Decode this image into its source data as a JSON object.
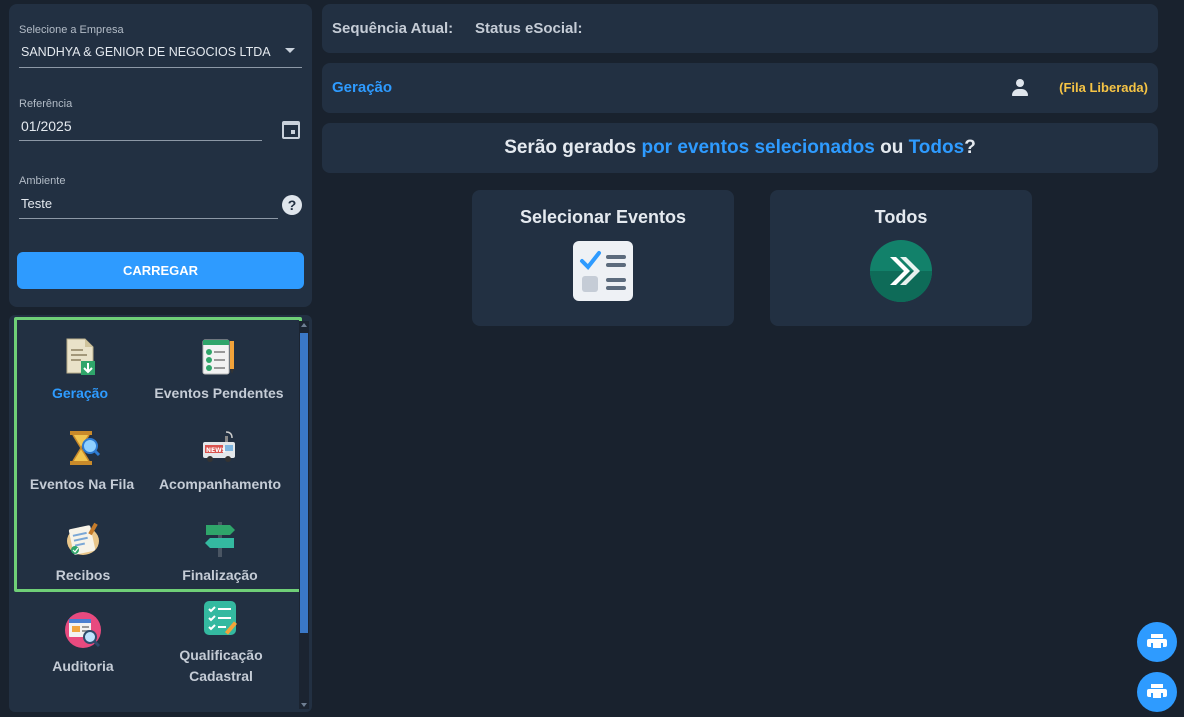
{
  "form": {
    "empresa_label": "Selecione a Empresa",
    "empresa_value": "SANDHYA & GENIOR DE NEGOCIOS LTDA",
    "referencia_label": "Referência",
    "referencia_value": "01/2025",
    "ambiente_label": "Ambiente",
    "ambiente_value": "Teste",
    "help_glyph": "?",
    "carregar_label": "CARREGAR"
  },
  "menu": {
    "items": [
      {
        "label": "Geração",
        "icon": "document-download-icon",
        "active": true
      },
      {
        "label": "Eventos Pendentes",
        "icon": "checklist-pencil-icon"
      },
      {
        "label": "Eventos Na Fila",
        "icon": "hourglass-search-icon"
      },
      {
        "label": "Acompanhamento",
        "icon": "news-van-icon"
      },
      {
        "label": "Recibos",
        "icon": "receipt-stamp-icon"
      },
      {
        "label": "Finalização",
        "icon": "signpost-icon"
      },
      {
        "label": "Auditoria",
        "icon": "audit-magnifier-icon"
      },
      {
        "label_line1": "Qualificação",
        "label_line2": "Cadastral",
        "icon": "qualification-checklist-icon"
      }
    ]
  },
  "status_bar": {
    "sequencia_label": "Sequência Atual:",
    "status_label": "Status eSocial:"
  },
  "geracao_bar": {
    "title": "Geração",
    "fila_status": "(Fila Liberada)"
  },
  "question": {
    "part1": "Serão gerados ",
    "hl1": "por eventos selecionados",
    "part2": " ou ",
    "hl2": "Todos",
    "part3": "?"
  },
  "cards": {
    "selecionar_title": "Selecionar Eventos",
    "todos_title": "Todos"
  },
  "colors": {
    "accent": "#2e9bff",
    "warning": "#f6c445",
    "highlight_border": "#6fcf77",
    "panel": "#223042",
    "background": "#19222e"
  }
}
